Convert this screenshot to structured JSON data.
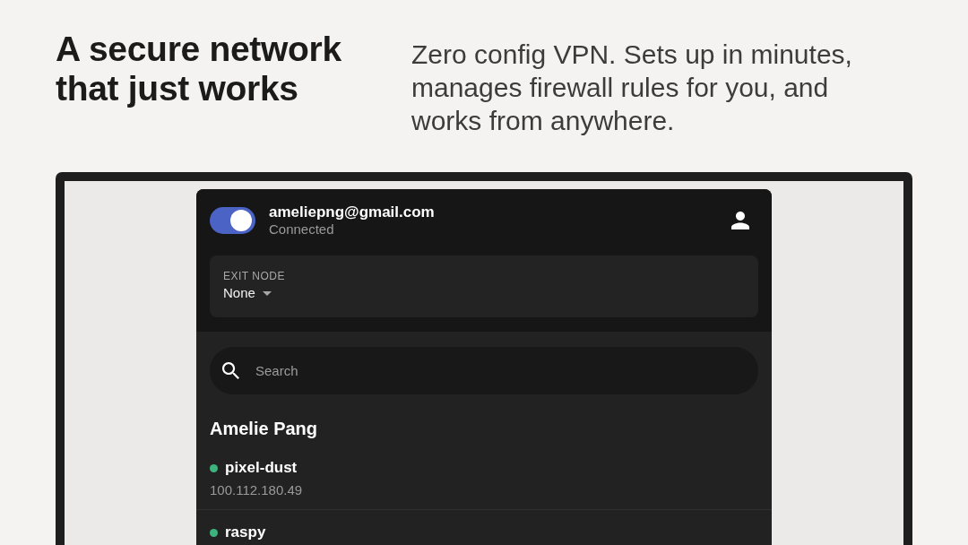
{
  "hero": {
    "headline": "A secure network that just works",
    "description": "Zero config VPN. Sets up in minutes, manages firewall rules for you, and works from anywhere."
  },
  "app": {
    "vpn_toggle": {
      "on": true
    },
    "account": {
      "email": "ameliepng@gmail.com",
      "status": "Connected"
    },
    "exit_node": {
      "label": "EXIT NODE",
      "value": "None"
    },
    "search": {
      "placeholder": "Search"
    },
    "owner": "Amelie Pang",
    "devices": [
      {
        "name": "pixel-dust",
        "address": "100.112.180.49",
        "online": true
      },
      {
        "name": "raspy",
        "online": true
      }
    ]
  }
}
